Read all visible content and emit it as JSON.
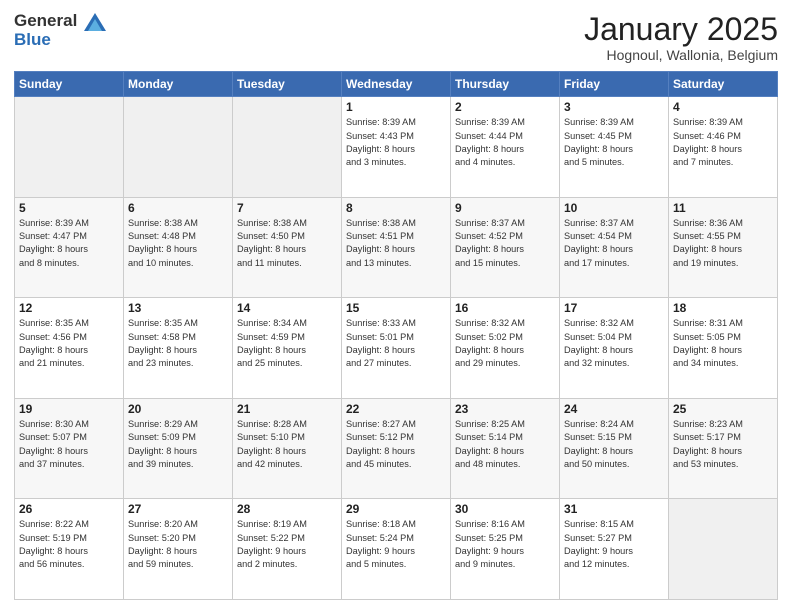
{
  "header": {
    "logo_general": "General",
    "logo_blue": "Blue",
    "month_title": "January 2025",
    "location": "Hognoul, Wallonia, Belgium"
  },
  "calendar": {
    "days_of_week": [
      "Sunday",
      "Monday",
      "Tuesday",
      "Wednesday",
      "Thursday",
      "Friday",
      "Saturday"
    ],
    "weeks": [
      [
        {
          "day": "",
          "info": ""
        },
        {
          "day": "",
          "info": ""
        },
        {
          "day": "",
          "info": ""
        },
        {
          "day": "1",
          "info": "Sunrise: 8:39 AM\nSunset: 4:43 PM\nDaylight: 8 hours\nand 3 minutes."
        },
        {
          "day": "2",
          "info": "Sunrise: 8:39 AM\nSunset: 4:44 PM\nDaylight: 8 hours\nand 4 minutes."
        },
        {
          "day": "3",
          "info": "Sunrise: 8:39 AM\nSunset: 4:45 PM\nDaylight: 8 hours\nand 5 minutes."
        },
        {
          "day": "4",
          "info": "Sunrise: 8:39 AM\nSunset: 4:46 PM\nDaylight: 8 hours\nand 7 minutes."
        }
      ],
      [
        {
          "day": "5",
          "info": "Sunrise: 8:39 AM\nSunset: 4:47 PM\nDaylight: 8 hours\nand 8 minutes."
        },
        {
          "day": "6",
          "info": "Sunrise: 8:38 AM\nSunset: 4:48 PM\nDaylight: 8 hours\nand 10 minutes."
        },
        {
          "day": "7",
          "info": "Sunrise: 8:38 AM\nSunset: 4:50 PM\nDaylight: 8 hours\nand 11 minutes."
        },
        {
          "day": "8",
          "info": "Sunrise: 8:38 AM\nSunset: 4:51 PM\nDaylight: 8 hours\nand 13 minutes."
        },
        {
          "day": "9",
          "info": "Sunrise: 8:37 AM\nSunset: 4:52 PM\nDaylight: 8 hours\nand 15 minutes."
        },
        {
          "day": "10",
          "info": "Sunrise: 8:37 AM\nSunset: 4:54 PM\nDaylight: 8 hours\nand 17 minutes."
        },
        {
          "day": "11",
          "info": "Sunrise: 8:36 AM\nSunset: 4:55 PM\nDaylight: 8 hours\nand 19 minutes."
        }
      ],
      [
        {
          "day": "12",
          "info": "Sunrise: 8:35 AM\nSunset: 4:56 PM\nDaylight: 8 hours\nand 21 minutes."
        },
        {
          "day": "13",
          "info": "Sunrise: 8:35 AM\nSunset: 4:58 PM\nDaylight: 8 hours\nand 23 minutes."
        },
        {
          "day": "14",
          "info": "Sunrise: 8:34 AM\nSunset: 4:59 PM\nDaylight: 8 hours\nand 25 minutes."
        },
        {
          "day": "15",
          "info": "Sunrise: 8:33 AM\nSunset: 5:01 PM\nDaylight: 8 hours\nand 27 minutes."
        },
        {
          "day": "16",
          "info": "Sunrise: 8:32 AM\nSunset: 5:02 PM\nDaylight: 8 hours\nand 29 minutes."
        },
        {
          "day": "17",
          "info": "Sunrise: 8:32 AM\nSunset: 5:04 PM\nDaylight: 8 hours\nand 32 minutes."
        },
        {
          "day": "18",
          "info": "Sunrise: 8:31 AM\nSunset: 5:05 PM\nDaylight: 8 hours\nand 34 minutes."
        }
      ],
      [
        {
          "day": "19",
          "info": "Sunrise: 8:30 AM\nSunset: 5:07 PM\nDaylight: 8 hours\nand 37 minutes."
        },
        {
          "day": "20",
          "info": "Sunrise: 8:29 AM\nSunset: 5:09 PM\nDaylight: 8 hours\nand 39 minutes."
        },
        {
          "day": "21",
          "info": "Sunrise: 8:28 AM\nSunset: 5:10 PM\nDaylight: 8 hours\nand 42 minutes."
        },
        {
          "day": "22",
          "info": "Sunrise: 8:27 AM\nSunset: 5:12 PM\nDaylight: 8 hours\nand 45 minutes."
        },
        {
          "day": "23",
          "info": "Sunrise: 8:25 AM\nSunset: 5:14 PM\nDaylight: 8 hours\nand 48 minutes."
        },
        {
          "day": "24",
          "info": "Sunrise: 8:24 AM\nSunset: 5:15 PM\nDaylight: 8 hours\nand 50 minutes."
        },
        {
          "day": "25",
          "info": "Sunrise: 8:23 AM\nSunset: 5:17 PM\nDaylight: 8 hours\nand 53 minutes."
        }
      ],
      [
        {
          "day": "26",
          "info": "Sunrise: 8:22 AM\nSunset: 5:19 PM\nDaylight: 8 hours\nand 56 minutes."
        },
        {
          "day": "27",
          "info": "Sunrise: 8:20 AM\nSunset: 5:20 PM\nDaylight: 8 hours\nand 59 minutes."
        },
        {
          "day": "28",
          "info": "Sunrise: 8:19 AM\nSunset: 5:22 PM\nDaylight: 9 hours\nand 2 minutes."
        },
        {
          "day": "29",
          "info": "Sunrise: 8:18 AM\nSunset: 5:24 PM\nDaylight: 9 hours\nand 5 minutes."
        },
        {
          "day": "30",
          "info": "Sunrise: 8:16 AM\nSunset: 5:25 PM\nDaylight: 9 hours\nand 9 minutes."
        },
        {
          "day": "31",
          "info": "Sunrise: 8:15 AM\nSunset: 5:27 PM\nDaylight: 9 hours\nand 12 minutes."
        },
        {
          "day": "",
          "info": ""
        }
      ]
    ]
  }
}
